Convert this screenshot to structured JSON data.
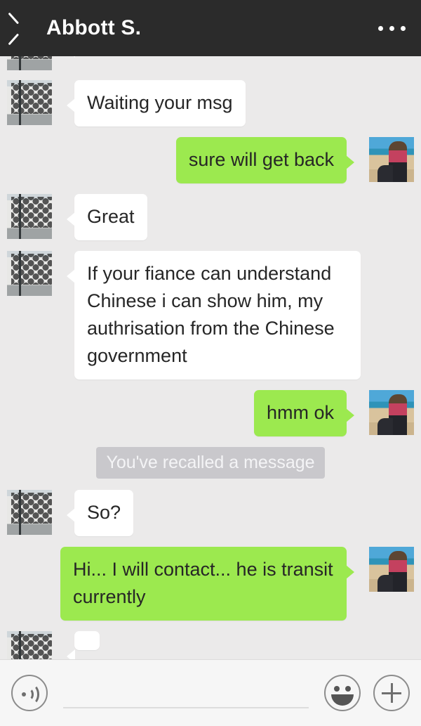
{
  "header": {
    "title": "Abbott S.",
    "back_icon": "chevron-left-icon",
    "menu_icon": "more-options-icon"
  },
  "conversation": {
    "contact_avatar_alt": "white-building-photo",
    "self_avatar_alt": "woman-at-beach-photo",
    "messages": [
      {
        "id": 1,
        "side": "in",
        "text": "",
        "clipped": true
      },
      {
        "id": 2,
        "side": "in",
        "text": "Waiting your msg"
      },
      {
        "id": 3,
        "side": "out",
        "text": "sure will get back"
      },
      {
        "id": 4,
        "side": "in",
        "text": "Great"
      },
      {
        "id": 5,
        "side": "in",
        "text": "If your fiance can understand Chinese i can show him, my authrisation from the Chinese government"
      },
      {
        "id": 6,
        "side": "out",
        "text": "hmm ok"
      },
      {
        "id": 7,
        "side": "system",
        "text": "You've recalled a message"
      },
      {
        "id": 8,
        "side": "in",
        "text": "So?"
      },
      {
        "id": 9,
        "side": "out",
        "text": "Hi... I will contact... he is transit currently"
      },
      {
        "id": 10,
        "side": "in",
        "text": "",
        "clipped": true
      }
    ]
  },
  "input_bar": {
    "voice_icon": "voice-message-icon",
    "emoji_icon": "smiley-face-icon",
    "add_icon": "plus-icon",
    "message_value": "",
    "message_placeholder": ""
  },
  "colors": {
    "header_bg": "#2b2b2b",
    "chat_bg": "#ebeaea",
    "outgoing_bubble": "#9ce94f",
    "incoming_bubble": "#ffffff",
    "system_pill": "#c9c8cc",
    "text": "#262626"
  }
}
